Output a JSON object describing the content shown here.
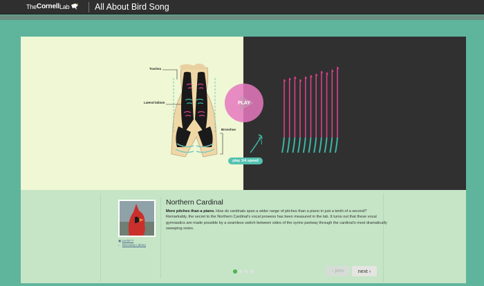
{
  "header": {
    "logo_the": "The",
    "logo_name": "Cornell",
    "logo_lab": "Lab",
    "app_title": "All About Bird Song"
  },
  "stage": {
    "labels": {
      "trachea": "Trachea",
      "labium": "Lateral labium",
      "bronchus": "Bronchus"
    },
    "play_label": "PLAY",
    "speed_label": "play 1/4 speed"
  },
  "info": {
    "bird_name": "Northern Cardinal",
    "lead": "More pitches than a piano.",
    "body": " How do cardinals span a wider range of pitches than a piano in just a tenth of a second? Remarkably, the secret to the Northern Cardinal's vocal prowess has been measured in the lab. It turns out that these vocal gymnastics are made possible by a seamless switch between sides of the syrinx partway through the cardinal's most dramatically sweeping notes.",
    "photo_credit": "evelin??",
    "library_credit": "Macaulay Library",
    "prev_label": "prev",
    "next_label": "next",
    "pager": {
      "total": 4,
      "current": 1
    }
  },
  "colors": {
    "background": "#5fb49c",
    "left_panel": "#eff7d4",
    "right_panel": "#303030",
    "magenta": "#d9418c",
    "teal": "#3fb5a4",
    "play_button": "#e678be"
  },
  "icons": [
    "cornell-bird-icon",
    "camera-icon",
    "speaker-icon",
    "chevron-left-icon",
    "chevron-right-icon"
  ]
}
